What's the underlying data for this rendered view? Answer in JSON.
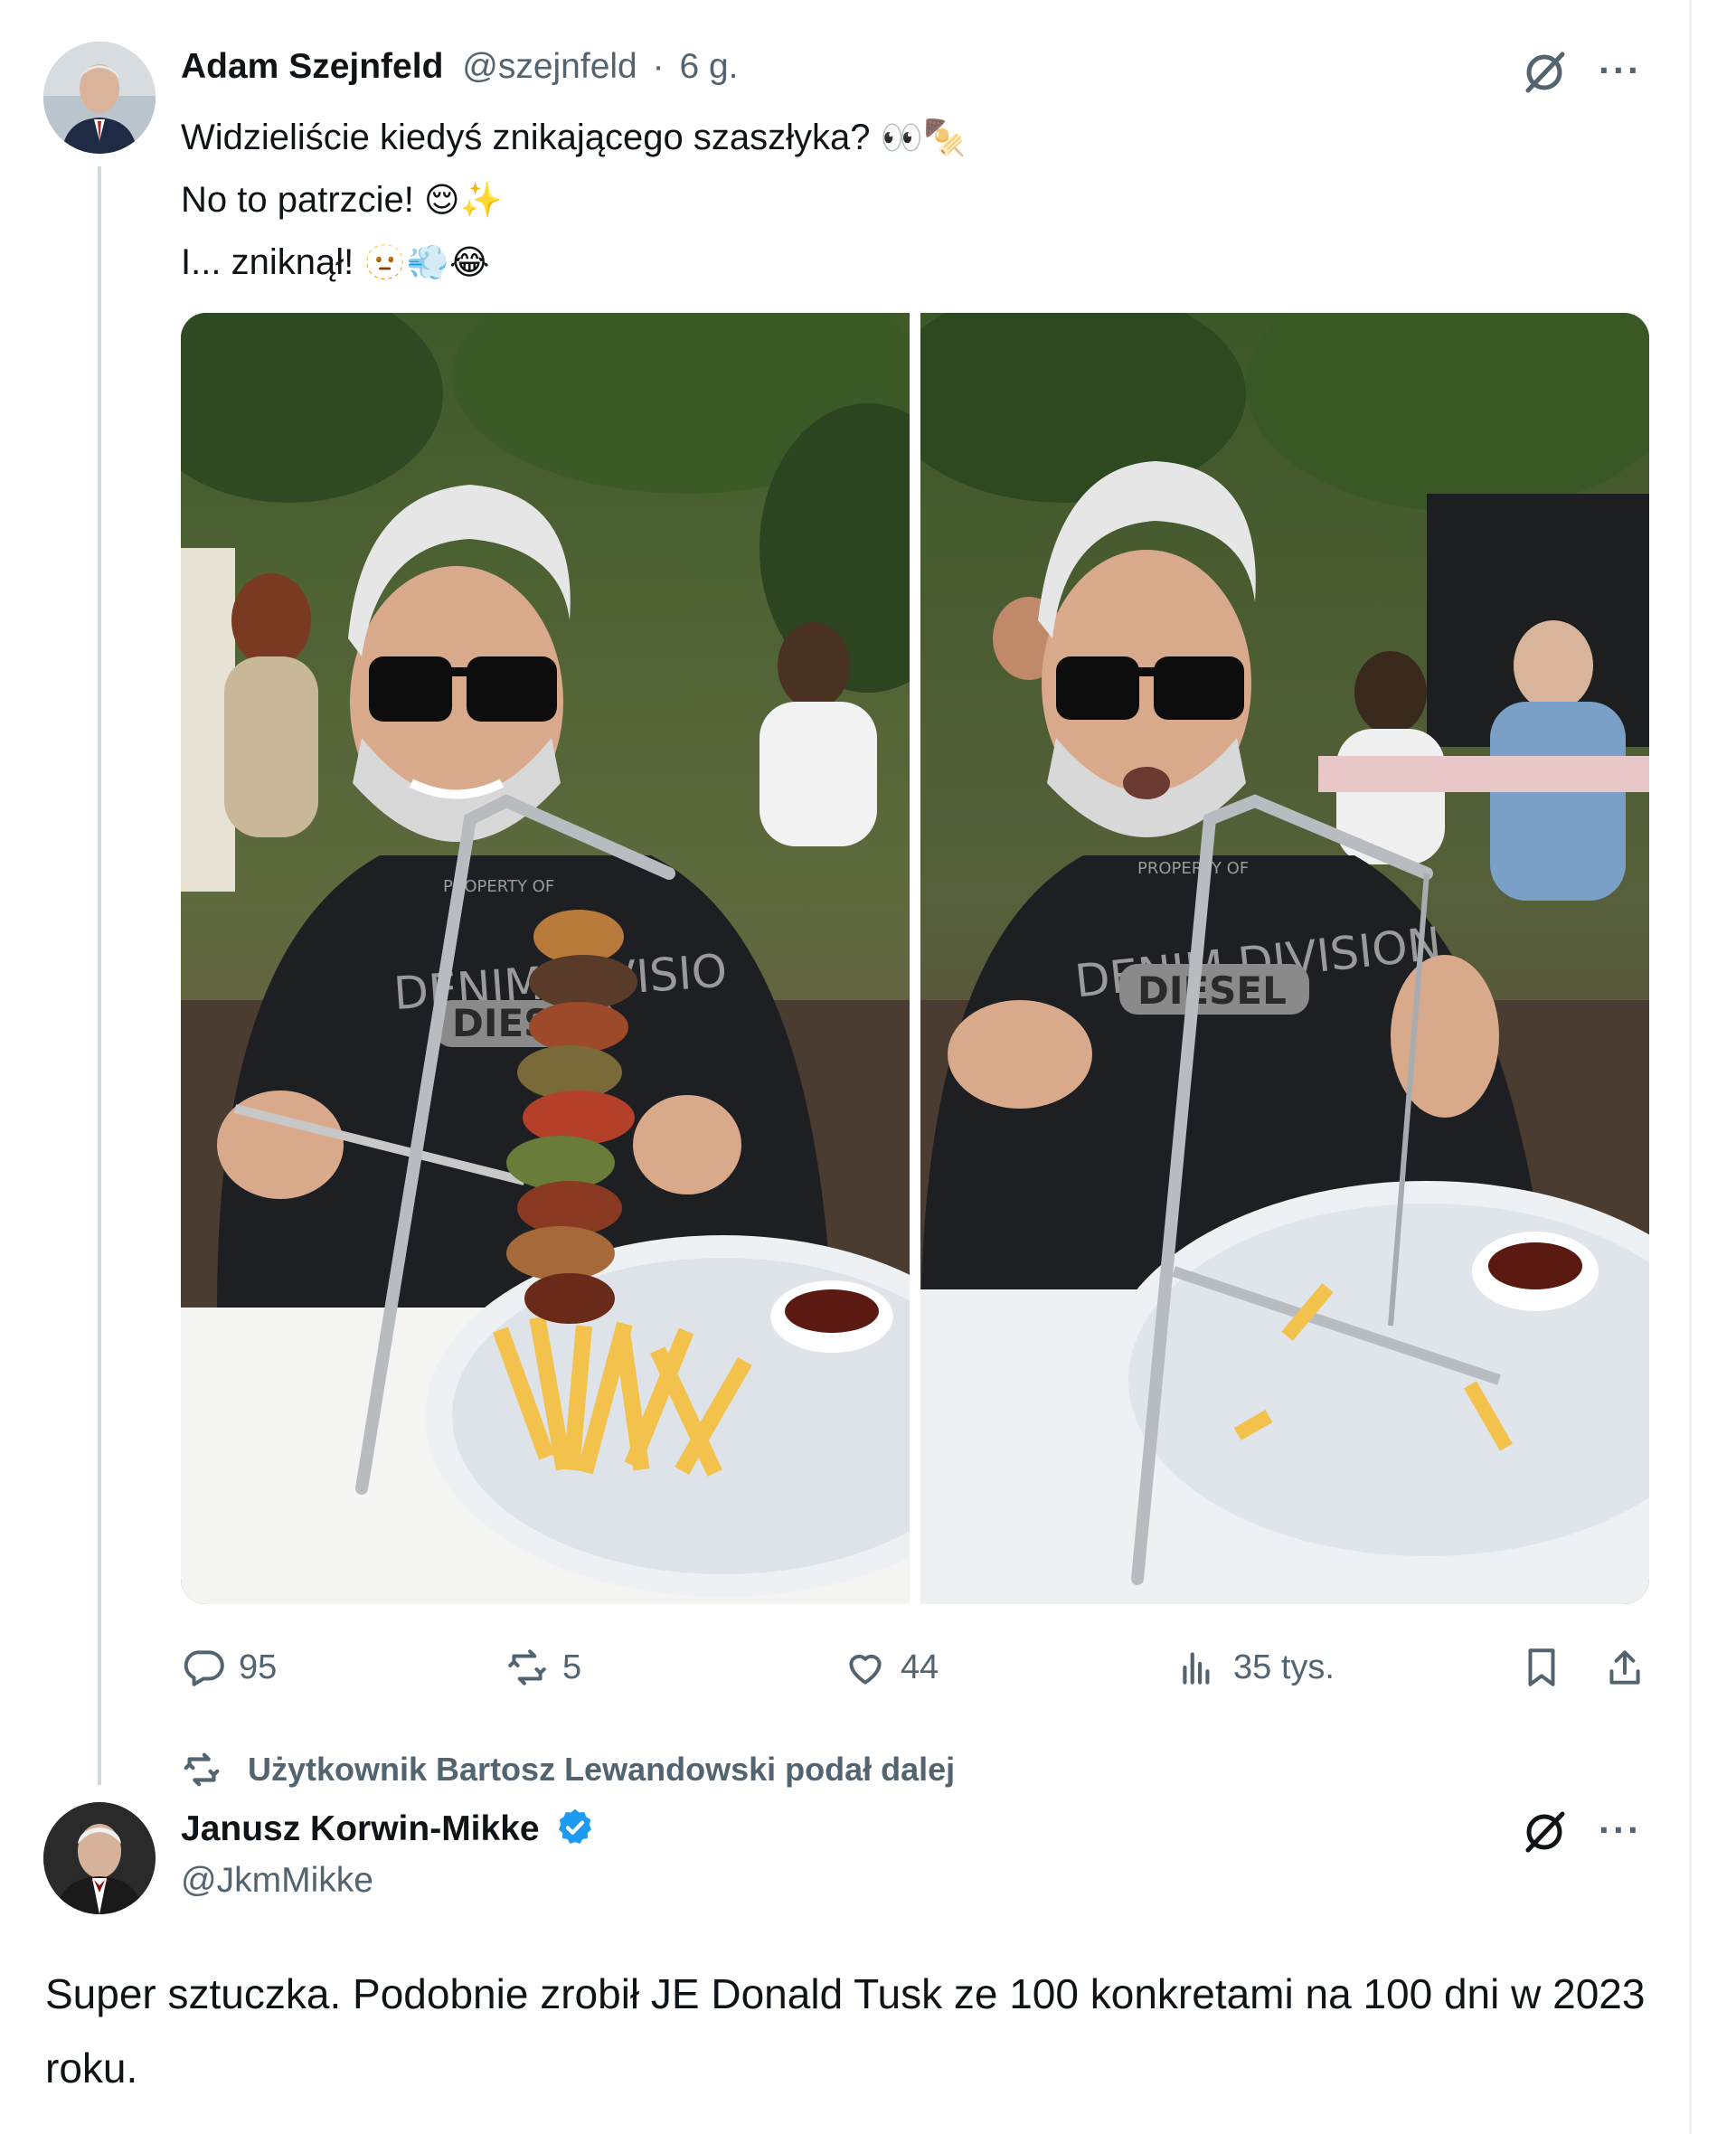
{
  "tweet": {
    "author_name": "Adam Szejnfeld",
    "handle": "@szejnfeld",
    "separator": "·",
    "time": "6 g.",
    "text_lines": [
      {
        "text": "Widzieliście kiedyś znikającego szaszłyka?",
        "emoji": "👀🍢"
      },
      {
        "text": "No to patrzcie!",
        "emoji": "😌✨"
      },
      {
        "text": "I... zniknął!",
        "emoji": "🫥💨😂"
      }
    ],
    "more_label": "···",
    "actions": {
      "replies": "95",
      "reposts": "5",
      "likes": "44",
      "views": "35 tys."
    }
  },
  "retweet_note": {
    "text": "Użytkownik Bartosz Lewandowski podał dalej"
  },
  "reply": {
    "author_name": "Janusz Korwin-Mikke",
    "handle": "@JkmMikke",
    "more_label": "···",
    "text": "Super sztuczka. Podobnie zrobił JE Donald Tusk ze 100 konkretami na 100 dni w 2023 roku."
  },
  "colors": {
    "text": "#0f1419",
    "muted": "#536471",
    "verified": "#1d9bf0",
    "thread_line": "#cfd9de"
  },
  "icons": [
    "grok-icon",
    "more-icon",
    "reply-icon",
    "repost-icon",
    "like-icon",
    "views-icon",
    "bookmark-icon",
    "share-icon",
    "verified-badge-icon"
  ]
}
